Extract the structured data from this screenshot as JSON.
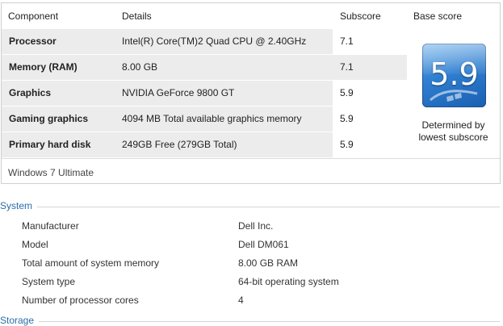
{
  "table": {
    "headers": {
      "component": "Component",
      "details": "Details",
      "subscore": "Subscore",
      "base_score": "Base score"
    },
    "rows": [
      {
        "component": "Processor",
        "details": "Intel(R) Core(TM)2 Quad CPU @ 2.40GHz",
        "subscore": "7.1"
      },
      {
        "component": "Memory (RAM)",
        "details": "8.00 GB",
        "subscore": "7.1"
      },
      {
        "component": "Graphics",
        "details": "NVIDIA GeForce 9800 GT",
        "subscore": "5.9"
      },
      {
        "component": "Gaming graphics",
        "details": "4094 MB Total available graphics memory",
        "subscore": "5.9"
      },
      {
        "component": "Primary hard disk",
        "details": "249GB Free (279GB Total)",
        "subscore": "5.9"
      }
    ],
    "base_score": {
      "value": "5.9",
      "caption_line1": "Determined by",
      "caption_line2": "lowest subscore"
    },
    "footer": "Windows 7 Ultimate"
  },
  "system": {
    "title": "System",
    "props": [
      {
        "label": "Manufacturer",
        "value": "Dell Inc."
      },
      {
        "label": "Model",
        "value": "Dell DM061"
      },
      {
        "label": "Total amount of system memory",
        "value": "8.00 GB RAM"
      },
      {
        "label": "System type",
        "value": "64-bit operating system"
      },
      {
        "label": "Number of processor cores",
        "value": "4"
      }
    ]
  },
  "storage": {
    "title": "Storage"
  },
  "colors": {
    "section_title": "#2b6da8",
    "row_shade": "#ececec",
    "badge_blue": "#2f7fd1"
  },
  "icons": {
    "badge_logo": "windows-logo-icon"
  }
}
